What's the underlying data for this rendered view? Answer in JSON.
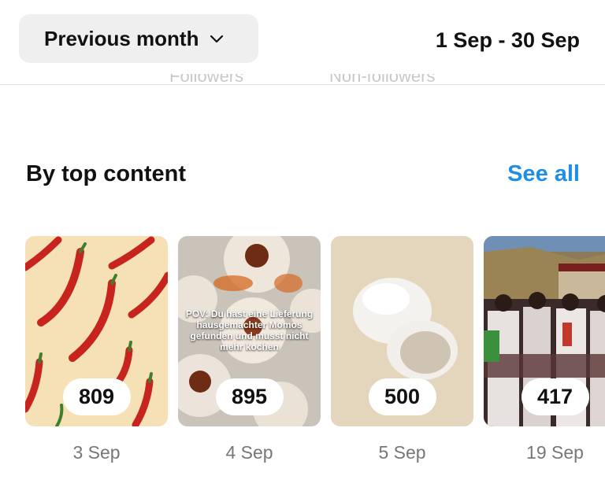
{
  "header": {
    "period_label": "Previous month",
    "date_range": "1 Sep - 30 Sep"
  },
  "ghost_labels": [
    "Followers",
    "Non-followers"
  ],
  "section": {
    "title": "By top content",
    "see_all": "See all"
  },
  "colors": {
    "accent": "#1f8fe6",
    "pill_bg": "#efefef"
  },
  "posts": [
    {
      "count": "809",
      "date": "3 Sep",
      "thumbnail": "red-chili-peppers-pattern",
      "overlay": ""
    },
    {
      "count": "895",
      "date": "4 Sep",
      "thumbnail": "momo-dumplings-photo",
      "overlay": "POV: Du hast eine Lieferung hausgemachter Momos gefunden und musst nicht mehr kochen"
    },
    {
      "count": "500",
      "date": "5 Sep",
      "thumbnail": "steamed-buns-photo",
      "overlay": ""
    },
    {
      "count": "417",
      "date": "19 Sep",
      "thumbnail": "tibetan-dancers-photo",
      "overlay": ""
    }
  ]
}
